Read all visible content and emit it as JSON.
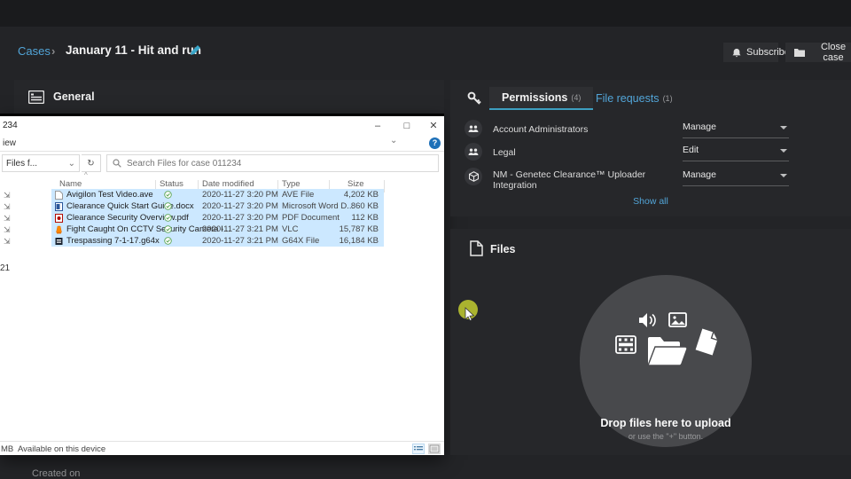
{
  "breadcrumb": {
    "cases": "Cases",
    "separator": "›",
    "title": "January 11 - Hit and run"
  },
  "actions": {
    "subscribe": "Subscribe",
    "close_case": "Close case"
  },
  "general": {
    "label": "General"
  },
  "explorer": {
    "title_remnant": "234",
    "menu_remnant": "iew",
    "window_controls": {
      "minimize": "–",
      "maximize": "□",
      "close": "✕"
    },
    "ribbon_chevron": "⌄",
    "help_glyph": "?",
    "address_remnant": "Files f...",
    "address_chevron": "⌄",
    "refresh_glyph": "↻",
    "search_placeholder": "Search Files for case 011234",
    "sort_glyph": "^",
    "columns": {
      "name": "Name",
      "status": "Status",
      "date": "Date modified",
      "type": "Type",
      "size": "Size"
    },
    "files": [
      {
        "name": "Avigilon Test Video.ave",
        "date": "2020-11-27 3:20 PM",
        "type": "AVE File",
        "size": "4,202 KB"
      },
      {
        "name": "Clearance Quick Start Guide.docx",
        "date": "2020-11-27 3:20 PM",
        "type": "Microsoft Word D...",
        "size": "860 KB"
      },
      {
        "name": "Clearance Security Overview.pdf",
        "date": "2020-11-27 3:20 PM",
        "type": "PDF Document",
        "size": "112 KB"
      },
      {
        "name": "Fight Caught On CCTV Security Camera I...",
        "date": "2020-11-27 3:21 PM",
        "type": "VLC",
        "size": "15,787 KB"
      },
      {
        "name": "Trespassing 7-1-17.g64x",
        "date": "2020-11-27 3:21 PM",
        "type": "G64X File",
        "size": "16,184 KB"
      }
    ],
    "left_rail_remnant": "21",
    "status_left_remnant": "MB",
    "status_text": "Available on this device"
  },
  "permissions": {
    "tab_permissions": "Permissions",
    "tab_permissions_count": "(4)",
    "tab_file_requests": "File requests",
    "tab_file_requests_count": "(1)",
    "rows": [
      {
        "name": "Account Administrators",
        "level": "Manage"
      },
      {
        "name": "Legal",
        "level": "Edit"
      },
      {
        "name": "NM - Genetec Clearance™ Uploader Integration",
        "level": "Manage"
      }
    ],
    "show_all": "Show all"
  },
  "files_section": {
    "title": "Files",
    "drop_title": "Drop files here to upload",
    "drop_subtitle": "or use the \"+\" button."
  },
  "footer": {
    "created_on": "Created on"
  },
  "colors": {
    "accent_blue": "#52a5d8",
    "tab_underline": "#3d9fc0",
    "selection": "#cce8ff",
    "check_green": "#5aa552",
    "highlight": "#aab32f"
  }
}
